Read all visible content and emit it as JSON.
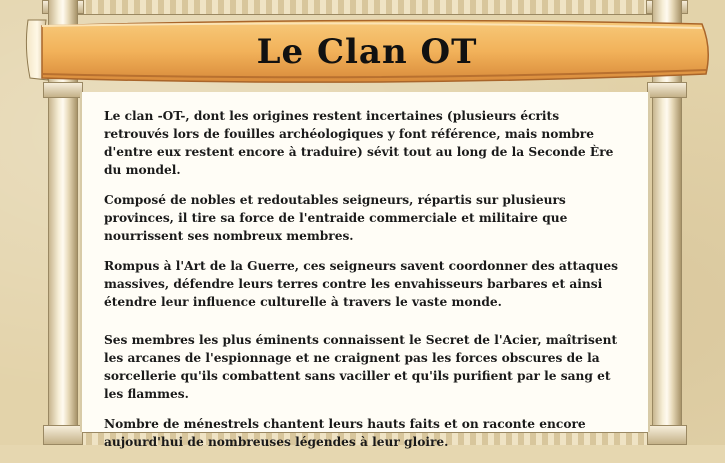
{
  "header": {
    "title": "Le Clan OT"
  },
  "paragraphs": [
    "Le clan -OT-, dont les origines restent incertaines (plusieurs écrits retrouvés lors de fouilles archéologiques y font référence, mais nombre d'entre eux restent encore à traduire) sévit tout au long de la Seconde Ère du mondel.",
    "Composé de nobles et redoutables seigneurs, répartis sur plusieurs provinces, il tire sa force de l'entraide commerciale et militaire que nourrissent ses nombreux membres.",
    "Rompus à l'Art de la Guerre, ces seigneurs savent coordonner des attaques massives, défendre leurs terres contre les envahisseurs barbares et ainsi étendre leur influence culturelle à travers le vaste monde.",
    "Ses membres les plus éminents connaissent le Secret de l'Acier, maîtrisent les arcanes de l'espionnage et ne craignent pas les forces obscures de la sorcellerie qu'ils combattent sans vaciller et qu'ils purifient par le sang et les flammes.",
    "Nombre de ménestrels chantent leurs hauts faits et on raconte encore aujourd'hui de nombreuses légendes à leur gloire."
  ],
  "colors": {
    "banner": "#f2b25a",
    "banner_dark": "#c0762a",
    "parchment": "#fffdf6",
    "background": "#e3d3aa"
  }
}
